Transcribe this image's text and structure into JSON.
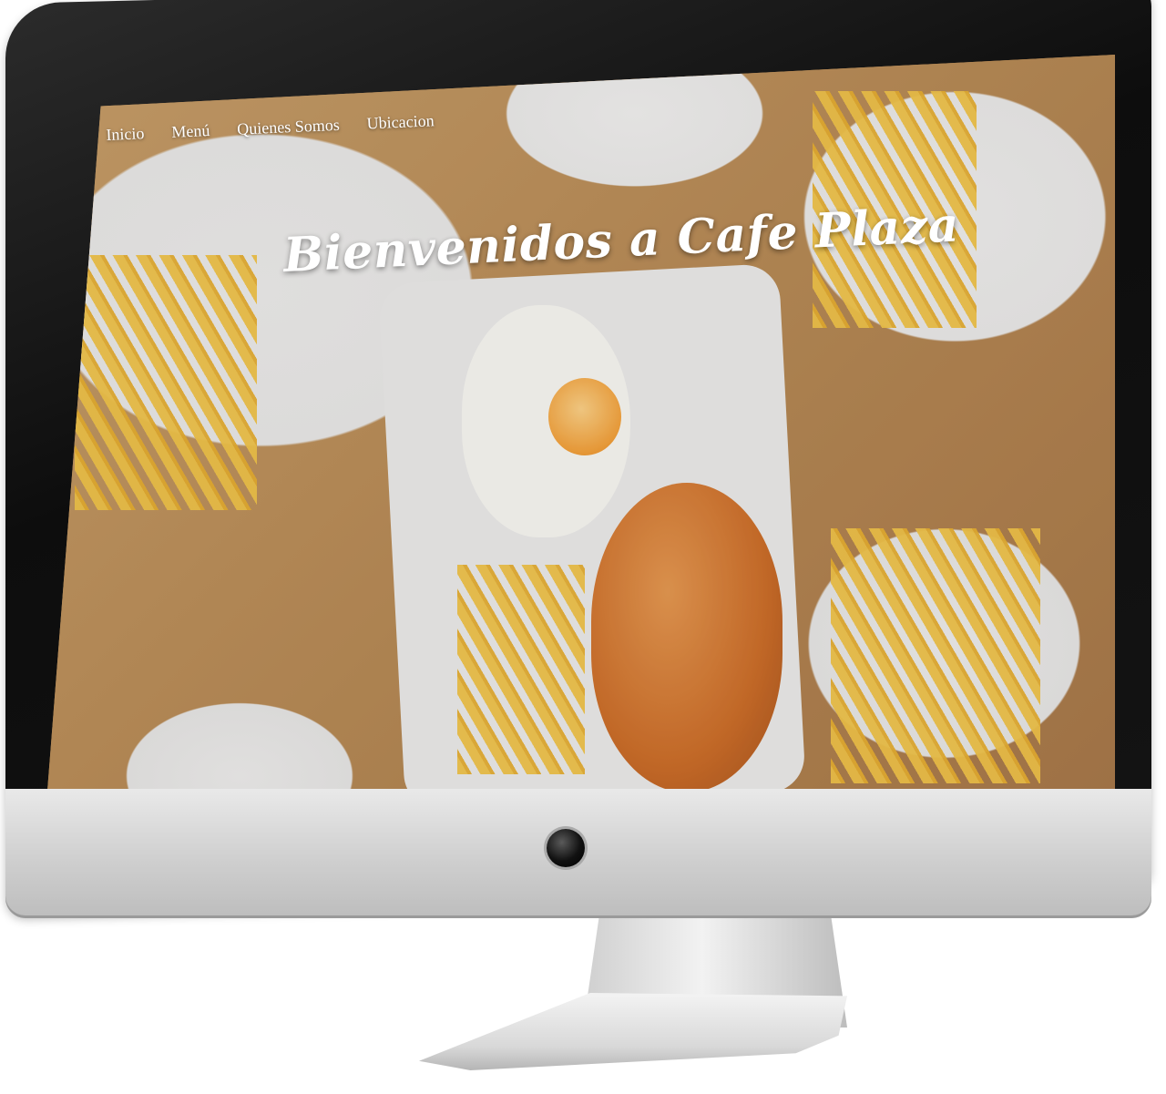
{
  "nav": {
    "items": [
      {
        "label": "Inicio"
      },
      {
        "label": "Menú"
      },
      {
        "label": "Quienes Somos"
      },
      {
        "label": "Ubicacion"
      }
    ]
  },
  "hero": {
    "title": "Bienvenidos a Cafe Plaza"
  },
  "colors": {
    "hero_text": "#ffffff",
    "table_wood": "#b98c57",
    "monitor_bezel": "#111111",
    "monitor_chin": "#d4d4d4"
  }
}
